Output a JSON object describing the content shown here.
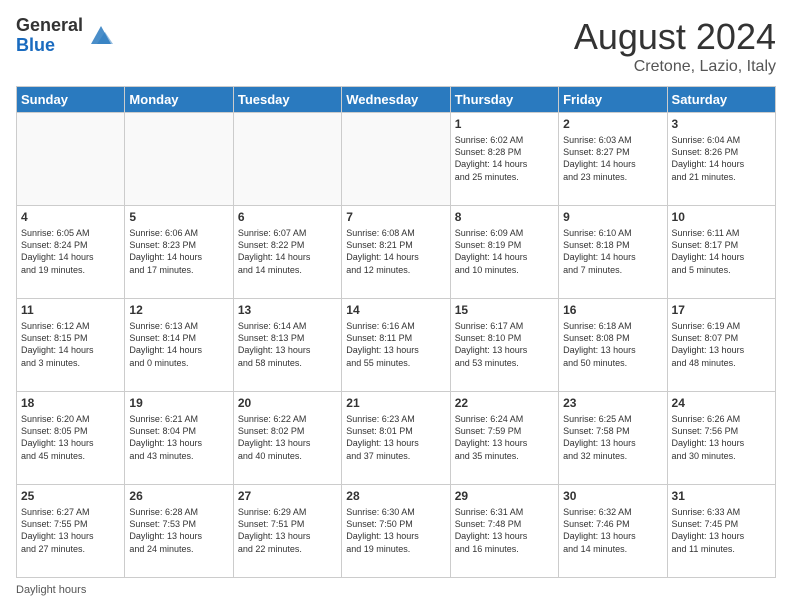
{
  "header": {
    "logo_general": "General",
    "logo_blue": "Blue",
    "month_year": "August 2024",
    "location": "Cretone, Lazio, Italy"
  },
  "days_of_week": [
    "Sunday",
    "Monday",
    "Tuesday",
    "Wednesday",
    "Thursday",
    "Friday",
    "Saturday"
  ],
  "footer": {
    "daylight_hours": "Daylight hours"
  },
  "weeks": [
    [
      {
        "day": "",
        "info": ""
      },
      {
        "day": "",
        "info": ""
      },
      {
        "day": "",
        "info": ""
      },
      {
        "day": "",
        "info": ""
      },
      {
        "day": "1",
        "info": "Sunrise: 6:02 AM\nSunset: 8:28 PM\nDaylight: 14 hours\nand 25 minutes."
      },
      {
        "day": "2",
        "info": "Sunrise: 6:03 AM\nSunset: 8:27 PM\nDaylight: 14 hours\nand 23 minutes."
      },
      {
        "day": "3",
        "info": "Sunrise: 6:04 AM\nSunset: 8:26 PM\nDaylight: 14 hours\nand 21 minutes."
      }
    ],
    [
      {
        "day": "4",
        "info": "Sunrise: 6:05 AM\nSunset: 8:24 PM\nDaylight: 14 hours\nand 19 minutes."
      },
      {
        "day": "5",
        "info": "Sunrise: 6:06 AM\nSunset: 8:23 PM\nDaylight: 14 hours\nand 17 minutes."
      },
      {
        "day": "6",
        "info": "Sunrise: 6:07 AM\nSunset: 8:22 PM\nDaylight: 14 hours\nand 14 minutes."
      },
      {
        "day": "7",
        "info": "Sunrise: 6:08 AM\nSunset: 8:21 PM\nDaylight: 14 hours\nand 12 minutes."
      },
      {
        "day": "8",
        "info": "Sunrise: 6:09 AM\nSunset: 8:19 PM\nDaylight: 14 hours\nand 10 minutes."
      },
      {
        "day": "9",
        "info": "Sunrise: 6:10 AM\nSunset: 8:18 PM\nDaylight: 14 hours\nand 7 minutes."
      },
      {
        "day": "10",
        "info": "Sunrise: 6:11 AM\nSunset: 8:17 PM\nDaylight: 14 hours\nand 5 minutes."
      }
    ],
    [
      {
        "day": "11",
        "info": "Sunrise: 6:12 AM\nSunset: 8:15 PM\nDaylight: 14 hours\nand 3 minutes."
      },
      {
        "day": "12",
        "info": "Sunrise: 6:13 AM\nSunset: 8:14 PM\nDaylight: 14 hours\nand 0 minutes."
      },
      {
        "day": "13",
        "info": "Sunrise: 6:14 AM\nSunset: 8:13 PM\nDaylight: 13 hours\nand 58 minutes."
      },
      {
        "day": "14",
        "info": "Sunrise: 6:16 AM\nSunset: 8:11 PM\nDaylight: 13 hours\nand 55 minutes."
      },
      {
        "day": "15",
        "info": "Sunrise: 6:17 AM\nSunset: 8:10 PM\nDaylight: 13 hours\nand 53 minutes."
      },
      {
        "day": "16",
        "info": "Sunrise: 6:18 AM\nSunset: 8:08 PM\nDaylight: 13 hours\nand 50 minutes."
      },
      {
        "day": "17",
        "info": "Sunrise: 6:19 AM\nSunset: 8:07 PM\nDaylight: 13 hours\nand 48 minutes."
      }
    ],
    [
      {
        "day": "18",
        "info": "Sunrise: 6:20 AM\nSunset: 8:05 PM\nDaylight: 13 hours\nand 45 minutes."
      },
      {
        "day": "19",
        "info": "Sunrise: 6:21 AM\nSunset: 8:04 PM\nDaylight: 13 hours\nand 43 minutes."
      },
      {
        "day": "20",
        "info": "Sunrise: 6:22 AM\nSunset: 8:02 PM\nDaylight: 13 hours\nand 40 minutes."
      },
      {
        "day": "21",
        "info": "Sunrise: 6:23 AM\nSunset: 8:01 PM\nDaylight: 13 hours\nand 37 minutes."
      },
      {
        "day": "22",
        "info": "Sunrise: 6:24 AM\nSunset: 7:59 PM\nDaylight: 13 hours\nand 35 minutes."
      },
      {
        "day": "23",
        "info": "Sunrise: 6:25 AM\nSunset: 7:58 PM\nDaylight: 13 hours\nand 32 minutes."
      },
      {
        "day": "24",
        "info": "Sunrise: 6:26 AM\nSunset: 7:56 PM\nDaylight: 13 hours\nand 30 minutes."
      }
    ],
    [
      {
        "day": "25",
        "info": "Sunrise: 6:27 AM\nSunset: 7:55 PM\nDaylight: 13 hours\nand 27 minutes."
      },
      {
        "day": "26",
        "info": "Sunrise: 6:28 AM\nSunset: 7:53 PM\nDaylight: 13 hours\nand 24 minutes."
      },
      {
        "day": "27",
        "info": "Sunrise: 6:29 AM\nSunset: 7:51 PM\nDaylight: 13 hours\nand 22 minutes."
      },
      {
        "day": "28",
        "info": "Sunrise: 6:30 AM\nSunset: 7:50 PM\nDaylight: 13 hours\nand 19 minutes."
      },
      {
        "day": "29",
        "info": "Sunrise: 6:31 AM\nSunset: 7:48 PM\nDaylight: 13 hours\nand 16 minutes."
      },
      {
        "day": "30",
        "info": "Sunrise: 6:32 AM\nSunset: 7:46 PM\nDaylight: 13 hours\nand 14 minutes."
      },
      {
        "day": "31",
        "info": "Sunrise: 6:33 AM\nSunset: 7:45 PM\nDaylight: 13 hours\nand 11 minutes."
      }
    ]
  ]
}
